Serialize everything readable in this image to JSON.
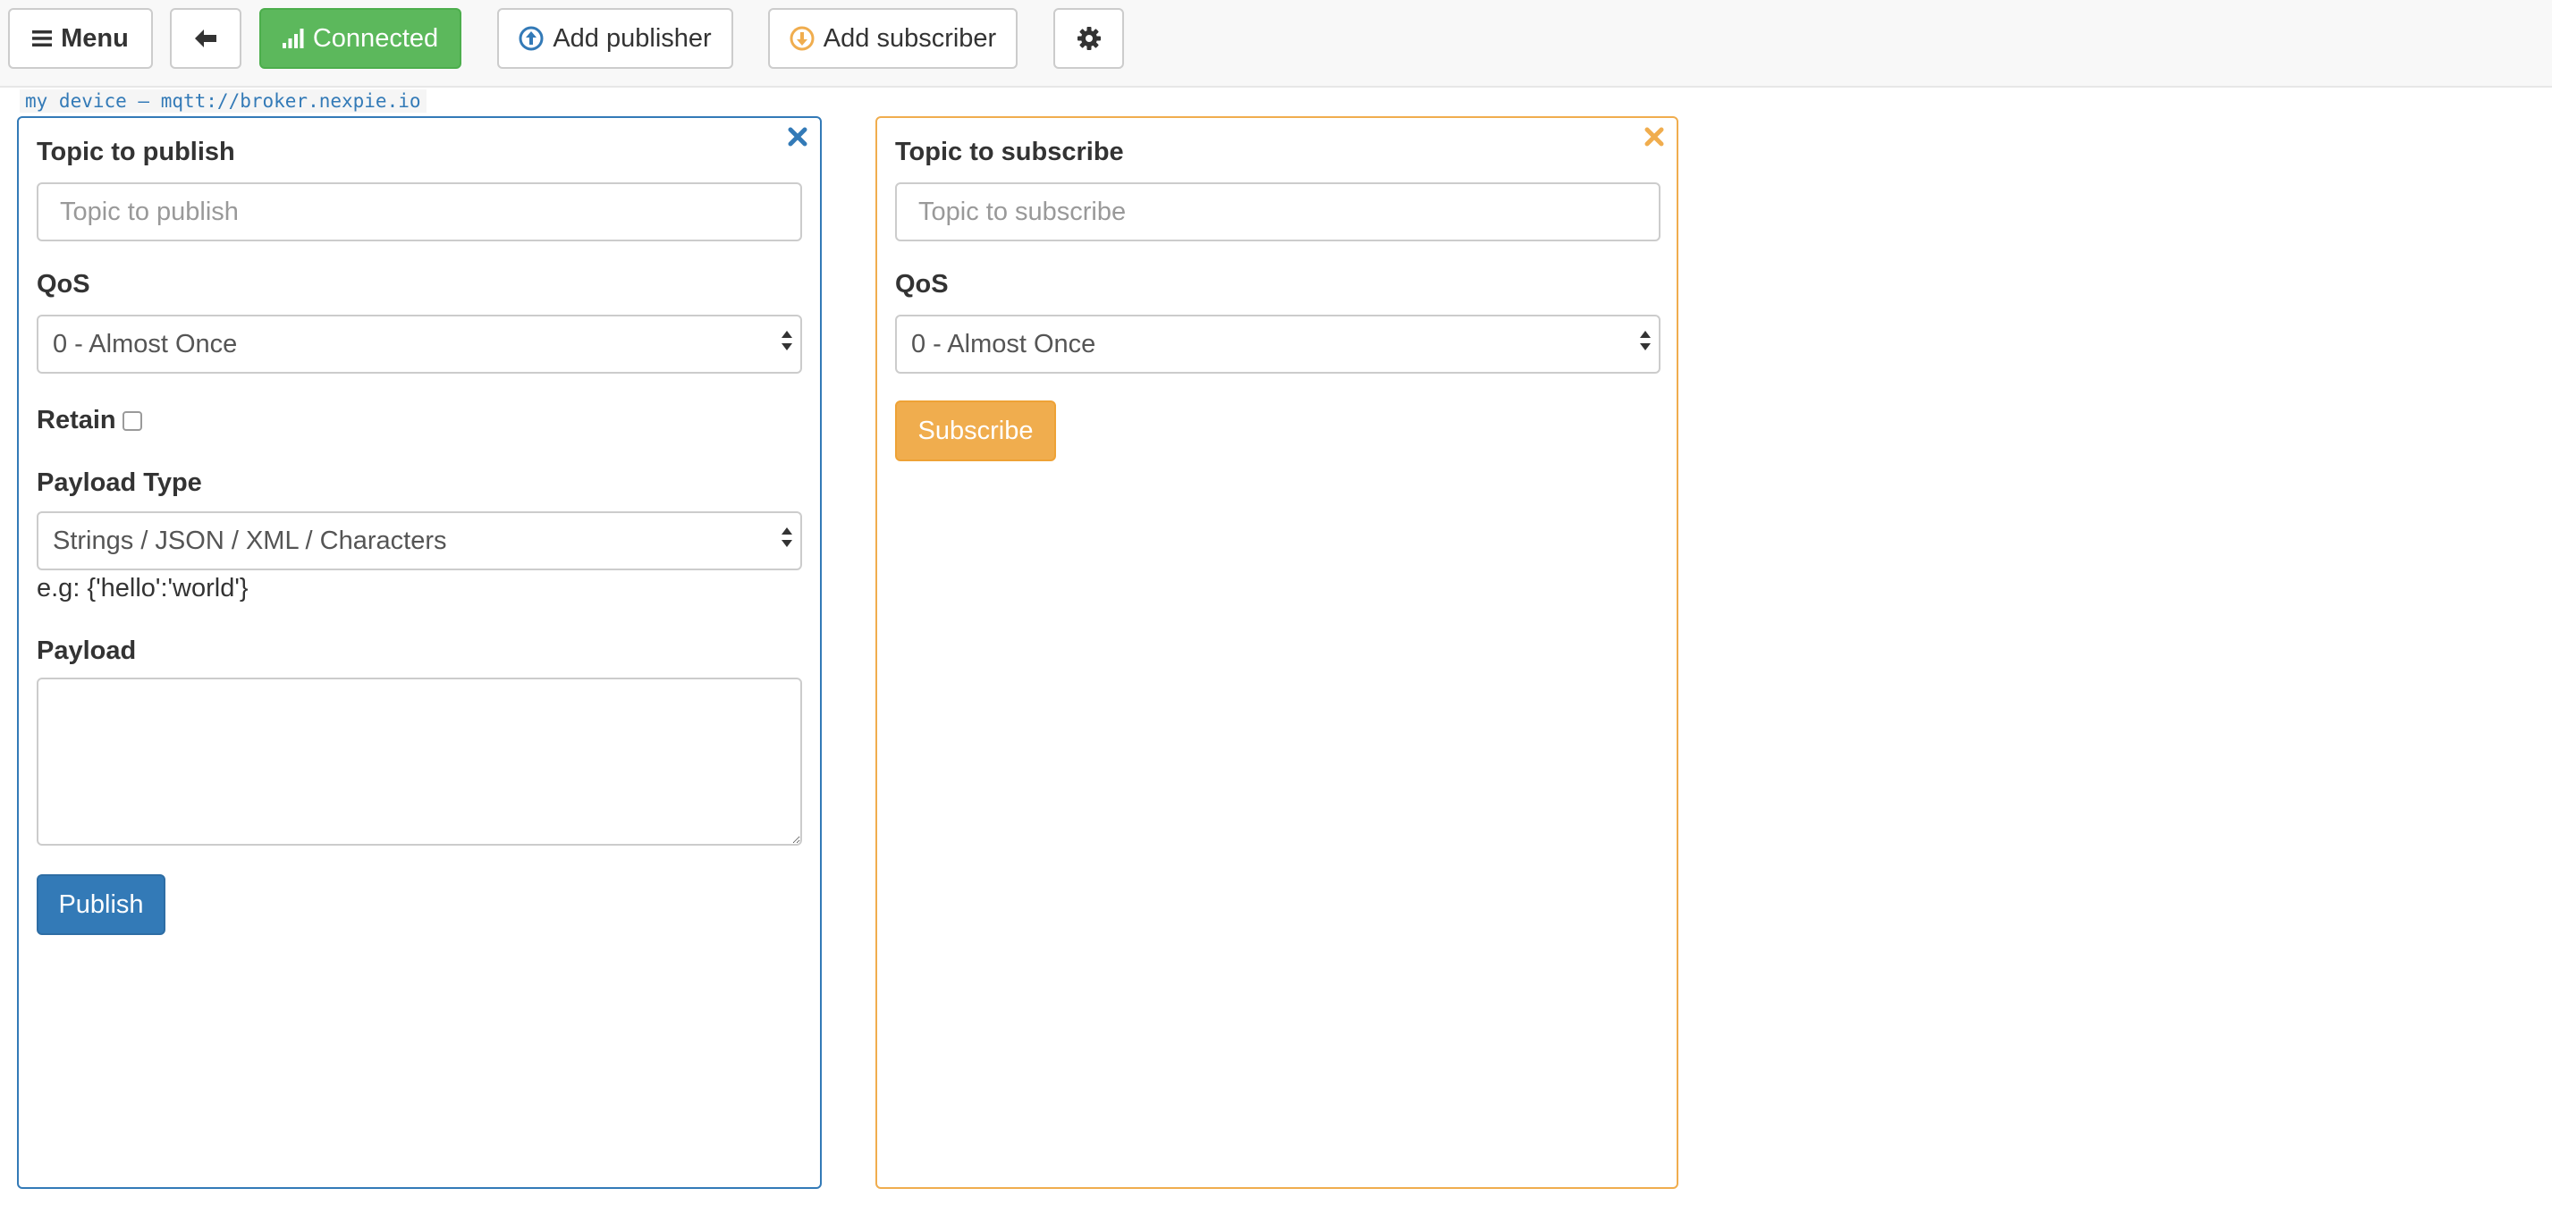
{
  "navbar": {
    "menu_label": "Menu",
    "menu_icon": "hamburger-icon",
    "back_icon": "arrow-left-icon",
    "status_label": "Connected",
    "status_icon": "signal-icon",
    "add_publisher_label": "Add publisher",
    "add_publisher_icon": "arrow-circle-up-icon",
    "add_subscriber_label": "Add subscriber",
    "add_subscriber_icon": "arrow-circle-down-icon",
    "settings_icon": "gear-icon"
  },
  "connection": {
    "label": "my device – mqtt://broker.nexpie.io"
  },
  "publisher": {
    "topic_label": "Topic to publish",
    "topic_placeholder": "Topic to publish",
    "topic_value": "",
    "qos_label": "QoS",
    "qos_selected": "0 - Almost Once",
    "retain_label": "Retain",
    "retain_checked": false,
    "payload_type_label": "Payload Type",
    "payload_type_selected": "Strings / JSON / XML / Characters",
    "payload_example": "e.g: {'hello':'world'}",
    "payload_label": "Payload",
    "payload_value": "",
    "publish_button": "Publish",
    "close_icon": "close-icon"
  },
  "subscriber": {
    "topic_label": "Topic to subscribe",
    "topic_placeholder": "Topic to subscribe",
    "topic_value": "",
    "qos_label": "QoS",
    "qos_selected": "0 - Almost Once",
    "subscribe_button": "Subscribe",
    "close_icon": "close-icon"
  },
  "colors": {
    "publisher_accent": "#337ab7",
    "subscriber_accent": "#f0ad4e",
    "connected": "#5cb85c",
    "navbar_bg": "#f8f8f8"
  }
}
